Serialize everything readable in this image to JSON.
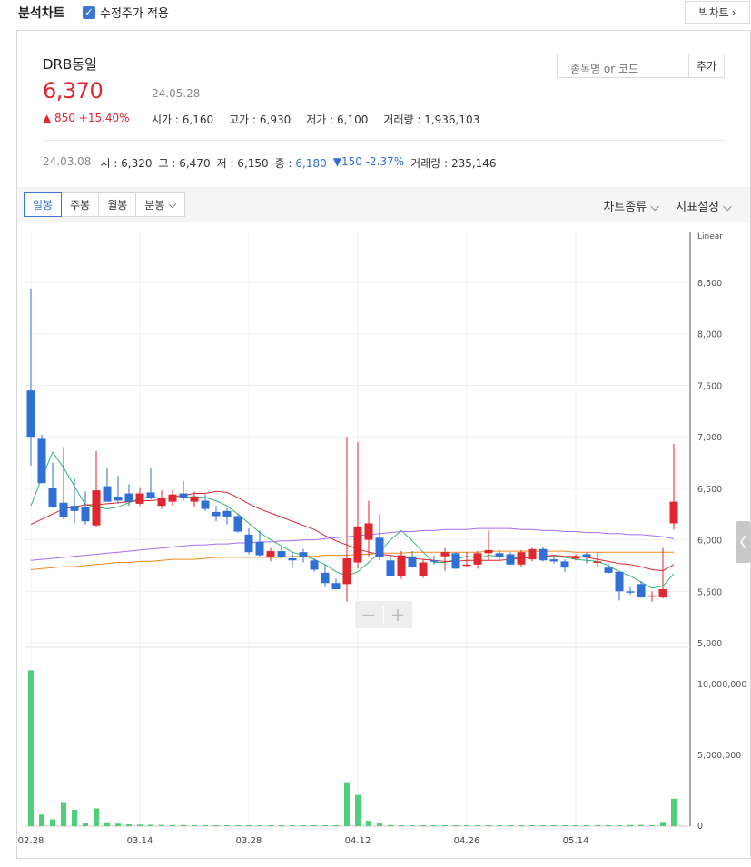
{
  "header": {
    "title": "분석차트",
    "adjusted_label": "수정주가 적용",
    "big_chart_label": "빅차트",
    "big_chart_icon": "chevron-right-icon"
  },
  "stock": {
    "name": "DRB동일",
    "price": "6,370",
    "date": "24.05.28",
    "change": "▲ 850 +15.40%",
    "stats": [
      {
        "label": "시가",
        "value": "6,160"
      },
      {
        "label": "고가",
        "value": "6,930"
      },
      {
        "label": "저가",
        "value": "6,100"
      },
      {
        "label": "거래량",
        "value": "1,936,103"
      }
    ]
  },
  "search": {
    "placeholder": "종목명 or 코드",
    "add_label": "추가"
  },
  "hover": {
    "date": "24.03.08",
    "open": "시 : 6,320",
    "high": "고 : 6,470",
    "low": "저 : 6,150",
    "close_label": "종 : ",
    "close_value": "6,180",
    "change": "▼150 -2.37%",
    "volume": "거래량 : 235,146"
  },
  "toolbar": {
    "tabs": [
      "일봉",
      "주봉",
      "월봉",
      "분봉"
    ],
    "active_tab": "일봉",
    "chart_type": "차트종류",
    "indicator": "지표설정"
  },
  "zoom": {
    "minus": "−",
    "plus": "+"
  },
  "colors": {
    "up": "#e0262f",
    "down": "#2f6fd6",
    "volume": "#4fcf7a",
    "ma5": "#2fb86a",
    "ma20": "#e0262f",
    "ma60": "#f08a1c",
    "ma120": "#a66cf0"
  },
  "chart_data": {
    "type": "candlestick",
    "scale": "Linear",
    "price_ticks": [
      "5,000",
      "5,500",
      "6,000",
      "6,500",
      "7,000",
      "7,500",
      "8,000",
      "8,500"
    ],
    "price_range": [
      5000,
      8950
    ],
    "volume_ticks": [
      "0",
      "5,000,000",
      "10,000,000"
    ],
    "volume_range": [
      0,
      12500000
    ],
    "x_ticks": [
      {
        "label": "02.28",
        "i": 0
      },
      {
        "label": "03.14",
        "i": 10
      },
      {
        "label": "03.28",
        "i": 20
      },
      {
        "label": "04.12",
        "i": 30
      },
      {
        "label": "04.26",
        "i": 40
      },
      {
        "label": "05.14",
        "i": 50
      }
    ],
    "candles": [
      {
        "o": 7450,
        "h": 8440,
        "l": 6720,
        "c": 7000
      },
      {
        "o": 6980,
        "h": 7020,
        "l": 6580,
        "c": 6550
      },
      {
        "o": 6500,
        "h": 6750,
        "l": 6310,
        "c": 6320
      },
      {
        "o": 6360,
        "h": 6900,
        "l": 6200,
        "c": 6220
      },
      {
        "o": 6330,
        "h": 6600,
        "l": 6160,
        "c": 6280
      },
      {
        "o": 6320,
        "h": 6470,
        "l": 6150,
        "c": 6180
      },
      {
        "o": 6140,
        "h": 6860,
        "l": 6120,
        "c": 6480
      },
      {
        "o": 6520,
        "h": 6700,
        "l": 6380,
        "c": 6370
      },
      {
        "o": 6420,
        "h": 6620,
        "l": 6350,
        "c": 6380
      },
      {
        "o": 6450,
        "h": 6540,
        "l": 6330,
        "c": 6370
      },
      {
        "o": 6350,
        "h": 6510,
        "l": 6330,
        "c": 6450
      },
      {
        "o": 6460,
        "h": 6700,
        "l": 6390,
        "c": 6410
      },
      {
        "o": 6330,
        "h": 6480,
        "l": 6300,
        "c": 6410
      },
      {
        "o": 6370,
        "h": 6480,
        "l": 6330,
        "c": 6440
      },
      {
        "o": 6450,
        "h": 6570,
        "l": 6380,
        "c": 6410
      },
      {
        "o": 6370,
        "h": 6470,
        "l": 6320,
        "c": 6420
      },
      {
        "o": 6380,
        "h": 6440,
        "l": 6280,
        "c": 6300
      },
      {
        "o": 6270,
        "h": 6330,
        "l": 6180,
        "c": 6230
      },
      {
        "o": 6280,
        "h": 6310,
        "l": 6150,
        "c": 6220
      },
      {
        "o": 6230,
        "h": 6250,
        "l": 6070,
        "c": 6080
      },
      {
        "o": 6050,
        "h": 6110,
        "l": 5860,
        "c": 5880
      },
      {
        "o": 5980,
        "h": 6090,
        "l": 5840,
        "c": 5850
      },
      {
        "o": 5830,
        "h": 5920,
        "l": 5790,
        "c": 5890
      },
      {
        "o": 5890,
        "h": 5930,
        "l": 5820,
        "c": 5830
      },
      {
        "o": 5820,
        "h": 5880,
        "l": 5730,
        "c": 5800
      },
      {
        "o": 5880,
        "h": 5910,
        "l": 5780,
        "c": 5830
      },
      {
        "o": 5800,
        "h": 5820,
        "l": 5690,
        "c": 5710
      },
      {
        "o": 5680,
        "h": 5760,
        "l": 5540,
        "c": 5580
      },
      {
        "o": 5580,
        "h": 5620,
        "l": 5520,
        "c": 5520
      },
      {
        "o": 5570,
        "h": 7000,
        "l": 5400,
        "c": 5820
      },
      {
        "o": 5780,
        "h": 6950,
        "l": 5720,
        "c": 6130
      },
      {
        "o": 6000,
        "h": 6380,
        "l": 5840,
        "c": 6160
      },
      {
        "o": 6020,
        "h": 6250,
        "l": 5800,
        "c": 5830
      },
      {
        "o": 5800,
        "h": 5860,
        "l": 5650,
        "c": 5650
      },
      {
        "o": 5650,
        "h": 5890,
        "l": 5620,
        "c": 5850
      },
      {
        "o": 5840,
        "h": 5890,
        "l": 5730,
        "c": 5740
      },
      {
        "o": 5650,
        "h": 5810,
        "l": 5630,
        "c": 5780
      },
      {
        "o": 5800,
        "h": 5850,
        "l": 5760,
        "c": 5790
      },
      {
        "o": 5840,
        "h": 5920,
        "l": 5700,
        "c": 5880
      },
      {
        "o": 5870,
        "h": 5880,
        "l": 5720,
        "c": 5720
      },
      {
        "o": 5750,
        "h": 5880,
        "l": 5740,
        "c": 5760
      },
      {
        "o": 5760,
        "h": 5890,
        "l": 5720,
        "c": 5870
      },
      {
        "o": 5870,
        "h": 6090,
        "l": 5800,
        "c": 5900
      },
      {
        "o": 5870,
        "h": 5900,
        "l": 5800,
        "c": 5830
      },
      {
        "o": 5860,
        "h": 5880,
        "l": 5760,
        "c": 5760
      },
      {
        "o": 5760,
        "h": 5900,
        "l": 5740,
        "c": 5880
      },
      {
        "o": 5810,
        "h": 5920,
        "l": 5790,
        "c": 5910
      },
      {
        "o": 5910,
        "h": 5930,
        "l": 5790,
        "c": 5800
      },
      {
        "o": 5810,
        "h": 5840,
        "l": 5770,
        "c": 5790
      },
      {
        "o": 5790,
        "h": 5810,
        "l": 5690,
        "c": 5730
      },
      {
        "o": 5820,
        "h": 5860,
        "l": 5800,
        "c": 5830
      },
      {
        "o": 5860,
        "h": 5880,
        "l": 5770,
        "c": 5830
      },
      {
        "o": 5780,
        "h": 5880,
        "l": 5730,
        "c": 5790
      },
      {
        "o": 5730,
        "h": 5770,
        "l": 5670,
        "c": 5680
      },
      {
        "o": 5690,
        "h": 5700,
        "l": 5410,
        "c": 5500
      },
      {
        "o": 5500,
        "h": 5540,
        "l": 5470,
        "c": 5490
      },
      {
        "o": 5570,
        "h": 5600,
        "l": 5440,
        "c": 5440
      },
      {
        "o": 5460,
        "h": 5500,
        "l": 5400,
        "c": 5460
      },
      {
        "o": 5440,
        "h": 5920,
        "l": 5430,
        "c": 5520
      },
      {
        "o": 6160,
        "h": 6930,
        "l": 6100,
        "c": 6370
      }
    ],
    "volume": [
      11000000,
      820000,
      480000,
      1700000,
      1150000,
      235146,
      1250000,
      270000,
      180000,
      130000,
      110000,
      100000,
      90000,
      80000,
      80000,
      70000,
      70000,
      60000,
      60000,
      60000,
      50000,
      50000,
      40000,
      40000,
      40000,
      40000,
      40000,
      40000,
      30000,
      3100000,
      2200000,
      380000,
      200000,
      80000,
      60000,
      50000,
      50000,
      40000,
      40000,
      40000,
      40000,
      40000,
      40000,
      40000,
      40000,
      40000,
      40000,
      40000,
      40000,
      40000,
      40000,
      40000,
      40000,
      40000,
      40000,
      80000,
      90000,
      70000,
      300000,
      1936103
    ],
    "moving_averages": [
      {
        "name": "ma5",
        "start": 0,
        "values": [
          6330,
          6600,
          6850,
          6700,
          6520,
          6340,
          6320,
          6300,
          6320,
          6360,
          6400,
          6420,
          6400,
          6410,
          6410,
          6420,
          6410,
          6380,
          6330,
          6250,
          6160,
          6070,
          6000,
          5940,
          5880,
          5850,
          5810,
          5760,
          5690,
          5650,
          5690,
          5780,
          5880,
          6000,
          6090,
          5990,
          5880,
          5780,
          5780,
          5810,
          5840,
          5820,
          5850,
          5840,
          5830,
          5820,
          5830,
          5840,
          5840,
          5830,
          5810,
          5800,
          5790,
          5750,
          5690,
          5650,
          5590,
          5530,
          5550,
          5670
        ]
      },
      {
        "name": "ma20",
        "start": 0,
        "values": [
          6150,
          6200,
          6250,
          6300,
          6320,
          6340,
          6340,
          6350,
          6360,
          6370,
          6380,
          6380,
          6390,
          6420,
          6430,
          6450,
          6450,
          6470,
          6460,
          6410,
          6350,
          6300,
          6260,
          6220,
          6180,
          6140,
          6100,
          6040,
          5990,
          5950,
          5910,
          5880,
          5860,
          5850,
          5830,
          5820,
          5810,
          5800,
          5790,
          5790,
          5800,
          5800,
          5800,
          5800,
          5810,
          5820,
          5830,
          5840,
          5850,
          5840,
          5840,
          5830,
          5810,
          5790,
          5770,
          5760,
          5740,
          5710,
          5700,
          5760
        ]
      },
      {
        "name": "ma60",
        "start": 0,
        "values": [
          5710,
          5720,
          5730,
          5740,
          5740,
          5750,
          5760,
          5770,
          5780,
          5780,
          5790,
          5790,
          5800,
          5810,
          5810,
          5810,
          5820,
          5830,
          5830,
          5830,
          5830,
          5830,
          5830,
          5830,
          5840,
          5840,
          5840,
          5850,
          5850,
          5850,
          5860,
          5860,
          5870,
          5870,
          5870,
          5880,
          5880,
          5880,
          5880,
          5880,
          5880,
          5880,
          5890,
          5890,
          5890,
          5890,
          5890,
          5890,
          5890,
          5890,
          5880,
          5880,
          5880,
          5880,
          5880,
          5880,
          5880,
          5880,
          5880,
          5880
        ]
      },
      {
        "name": "ma120",
        "start": 0,
        "values": [
          5800,
          5810,
          5820,
          5830,
          5840,
          5850,
          5860,
          5870,
          5880,
          5890,
          5900,
          5910,
          5920,
          5930,
          5940,
          5950,
          5950,
          5960,
          5960,
          5970,
          5970,
          5980,
          5980,
          5990,
          5990,
          6000,
          6000,
          6010,
          6020,
          6030,
          6040,
          6050,
          6060,
          6070,
          6080,
          6080,
          6090,
          6090,
          6100,
          6100,
          6100,
          6110,
          6110,
          6110,
          6110,
          6100,
          6100,
          6090,
          6090,
          6080,
          6080,
          6070,
          6070,
          6060,
          6060,
          6050,
          6050,
          6040,
          6030,
          6010
        ]
      }
    ]
  }
}
